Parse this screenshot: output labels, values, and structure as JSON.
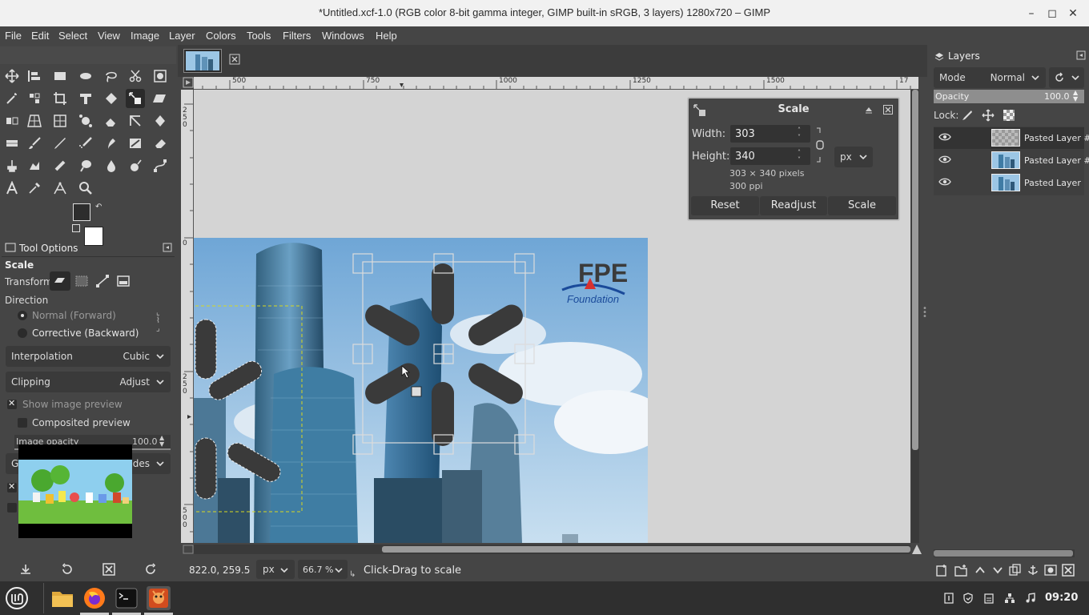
{
  "window": {
    "title": "*Untitled.xcf-1.0 (RGB color 8-bit gamma integer, GIMP built-in sRGB, 3 layers) 1280x720 – GIMP"
  },
  "menu": [
    "File",
    "Edit",
    "Select",
    "View",
    "Image",
    "Layer",
    "Colors",
    "Tools",
    "Filters",
    "Windows",
    "Help"
  ],
  "tool_options": {
    "tab_label": "Tool Options",
    "tool_name": "Scale",
    "transform_label": "Transform:",
    "direction_label": "Direction",
    "direction_normal": "Normal (Forward)",
    "direction_corrective": "Corrective (Backward)",
    "interpolation_label": "Interpolation",
    "interpolation_value": "Cubic",
    "clipping_label": "Clipping",
    "clipping_value": "Adjust",
    "show_preview_label": "Show image preview",
    "composited_preview_label": "Composited preview",
    "image_opacity_label": "Image opacity",
    "image_opacity_value": "100.0",
    "guides_label": "Gu",
    "guides_value": "ides"
  },
  "rulers": {
    "h_ticks": [
      "500",
      "750",
      "1000",
      "1250",
      "1500",
      "17"
    ],
    "v_ticks": [
      "250",
      "0",
      "250",
      "500"
    ]
  },
  "canvas": {
    "logo_text_line1": "FPE",
    "logo_text_line2": "Foundation"
  },
  "scale_dialog": {
    "title": "Scale",
    "width_label": "Width:",
    "width_value": "303",
    "height_label": "Height:",
    "height_value": "340",
    "unit": "px",
    "size_info": "303 × 340 pixels",
    "resolution_info": "300 ppi",
    "reset_label": "Reset",
    "readjust_label": "Readjust",
    "scale_label": "Scale"
  },
  "statusbar": {
    "coords": "822.0, 259.5",
    "unit": "px",
    "zoom": "66.7 %",
    "message": "Click-Drag to scale"
  },
  "layers": {
    "tab_label": "Layers",
    "mode_label": "Mode",
    "mode_value": "Normal",
    "opacity_label": "Opacity",
    "opacity_value": "100.0",
    "lock_label": "Lock:",
    "items": [
      {
        "name": "Pasted Layer #",
        "thumb": "transparent"
      },
      {
        "name": "Pasted Layer #",
        "thumb": "city"
      },
      {
        "name": "Pasted Layer",
        "thumb": "city"
      }
    ]
  },
  "taskbar": {
    "clock": "09:20"
  },
  "colors": {
    "accent": "#e66b16",
    "workspace": "#454545",
    "panel": "#3a3a3a"
  }
}
